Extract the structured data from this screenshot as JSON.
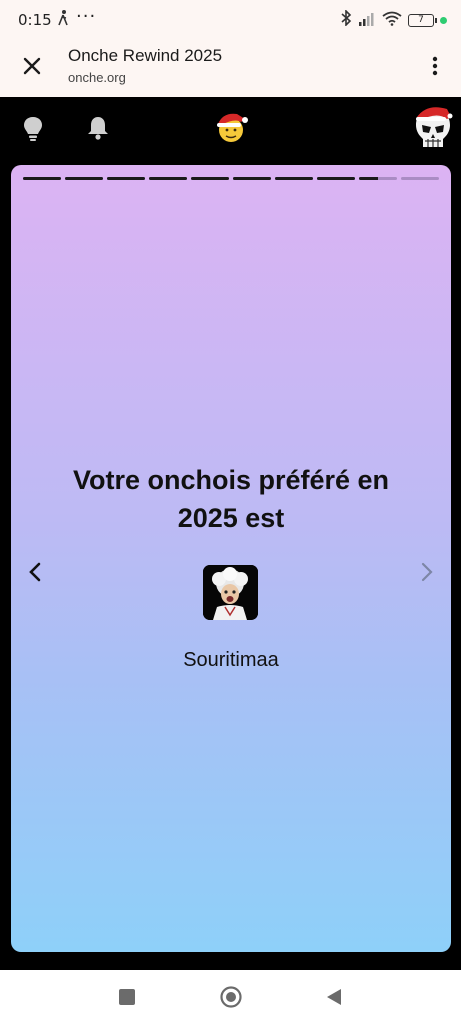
{
  "status_bar": {
    "time": "0:15",
    "dots": "···",
    "battery": "7"
  },
  "browser": {
    "title": "Onche Rewind 2025",
    "url": "onche.org"
  },
  "header_icons": [
    "lightbulb-icon",
    "bell-icon",
    "santa-emoji-icon",
    "skull-avatar-icon"
  ],
  "story": {
    "progress": [
      1,
      1,
      1,
      1,
      1,
      1,
      1,
      1,
      0.5,
      0
    ],
    "title": "Votre onchois préféré en 2025 est",
    "username": "Souritimaa"
  },
  "colors": {
    "gradient_top": "#dcb3f3",
    "gradient_bottom": "#8ed0f9",
    "browser_bar": "#fdf6f3"
  }
}
